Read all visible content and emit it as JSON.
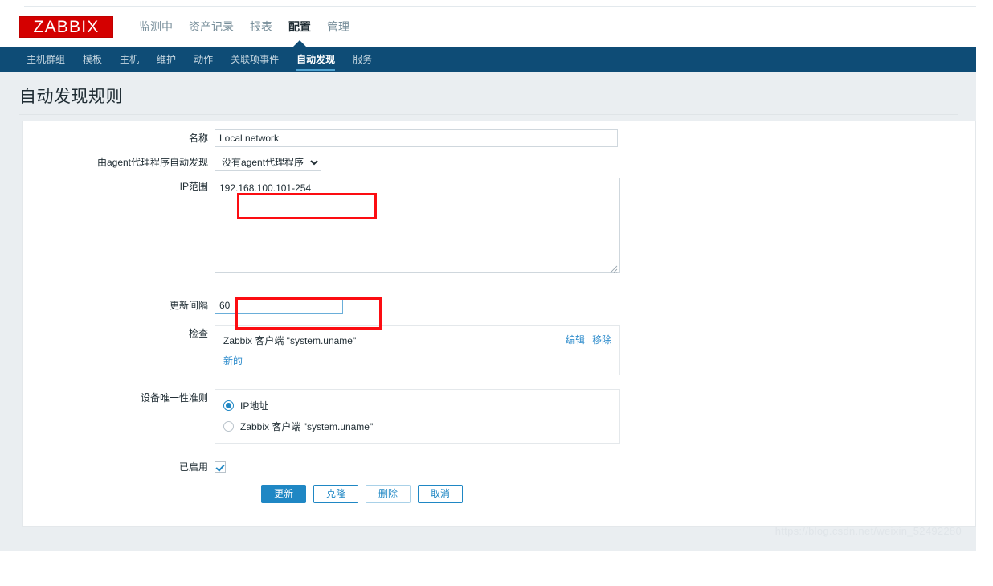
{
  "brand": {
    "logo_text": "ZABBIX",
    "logo_bg": "#d40000",
    "accent": "#1f87c4",
    "subnav_bg": "#0e4c76",
    "annotation_color": "#fc0d12"
  },
  "mainnav": {
    "items": [
      {
        "label": "监测中",
        "active": false
      },
      {
        "label": "资产记录",
        "active": false
      },
      {
        "label": "报表",
        "active": false
      },
      {
        "label": "配置",
        "active": true
      },
      {
        "label": "管理",
        "active": false
      }
    ]
  },
  "subnav": {
    "items": [
      {
        "label": "主机群组",
        "active": false
      },
      {
        "label": "模板",
        "active": false
      },
      {
        "label": "主机",
        "active": false
      },
      {
        "label": "维护",
        "active": false
      },
      {
        "label": "动作",
        "active": false
      },
      {
        "label": "关联项事件",
        "active": false
      },
      {
        "label": "自动发现",
        "active": true
      },
      {
        "label": "服务",
        "active": false
      }
    ]
  },
  "page": {
    "title": "自动发现规则"
  },
  "form": {
    "name": {
      "label": "名称",
      "value": "Local network",
      "placeholder": ""
    },
    "proxy": {
      "label": "由agent代理程序自动发现",
      "selected": "没有agent代理程序",
      "options": [
        "没有agent代理程序"
      ]
    },
    "ip_range": {
      "label": "IP范围",
      "value": "192.168.100.101-254",
      "placeholder": ""
    },
    "update_interval": {
      "label": "更新间隔",
      "value": "60",
      "placeholder": "",
      "focused": true
    },
    "checks": {
      "label": "检查",
      "items": [
        {
          "name": "Zabbix 客户端 \"system.uname\"",
          "edit_label": "编辑",
          "remove_label": "移除"
        }
      ],
      "new_label": "新的"
    },
    "uniqueness": {
      "label": "设备唯一性准则",
      "options": [
        {
          "label": "IP地址",
          "checked": true
        },
        {
          "label": "Zabbix 客户端 \"system.uname\"",
          "checked": false
        }
      ]
    },
    "enabled": {
      "label": "已启用",
      "checked": true
    },
    "buttons": [
      {
        "label": "更新",
        "style": "primary"
      },
      {
        "label": "克隆",
        "style": "secondary"
      },
      {
        "label": "删除",
        "style": "muted"
      },
      {
        "label": "取消",
        "style": "secondary"
      }
    ]
  },
  "watermark": {
    "text": "https://blog.csdn.net/weixin_52492280"
  }
}
